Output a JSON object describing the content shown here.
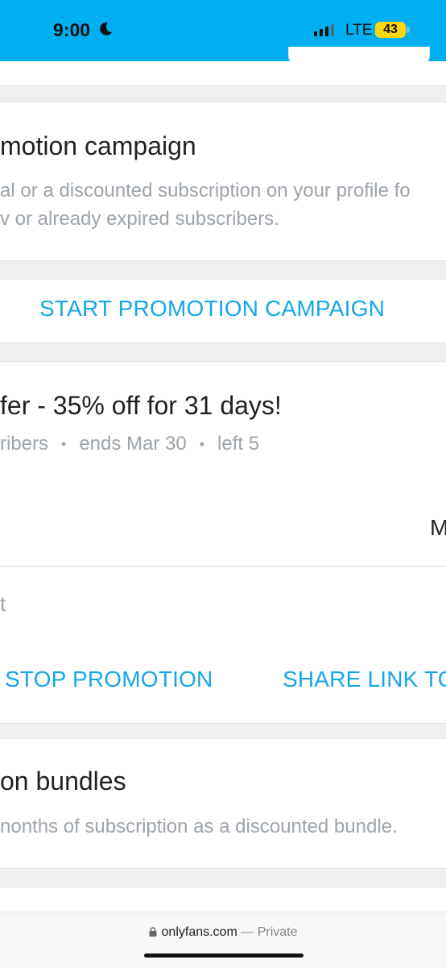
{
  "status": {
    "time": "9:00",
    "network": "LTE",
    "battery": "43"
  },
  "promo": {
    "title": "motion campaign",
    "desc_line1": "al or a discounted subscription on your profile fo",
    "desc_line2": "v or already expired subscribers.",
    "start_button": "START PROMOTION CAMPAIGN"
  },
  "offer": {
    "title": "fer - 35% off for 31 days!",
    "meta_subscribers": "ribers",
    "meta_ends": "ends Mar 30",
    "meta_left": "left 5",
    "right_letter": "M",
    "status_fragment": "t",
    "stop_button": "STOP PROMOTION",
    "share_button": "SHARE LINK TO"
  },
  "bundles": {
    "title": "on bundles",
    "desc": "nonths of subscription as a discounted bundle."
  },
  "browser": {
    "domain": "onlyfans.com",
    "separator": "—",
    "mode": "Private"
  },
  "colors": {
    "accent": "#00aff0",
    "link": "#16a7e8",
    "muted_text": "#9ea4ab",
    "battery": "#ffd60a"
  }
}
